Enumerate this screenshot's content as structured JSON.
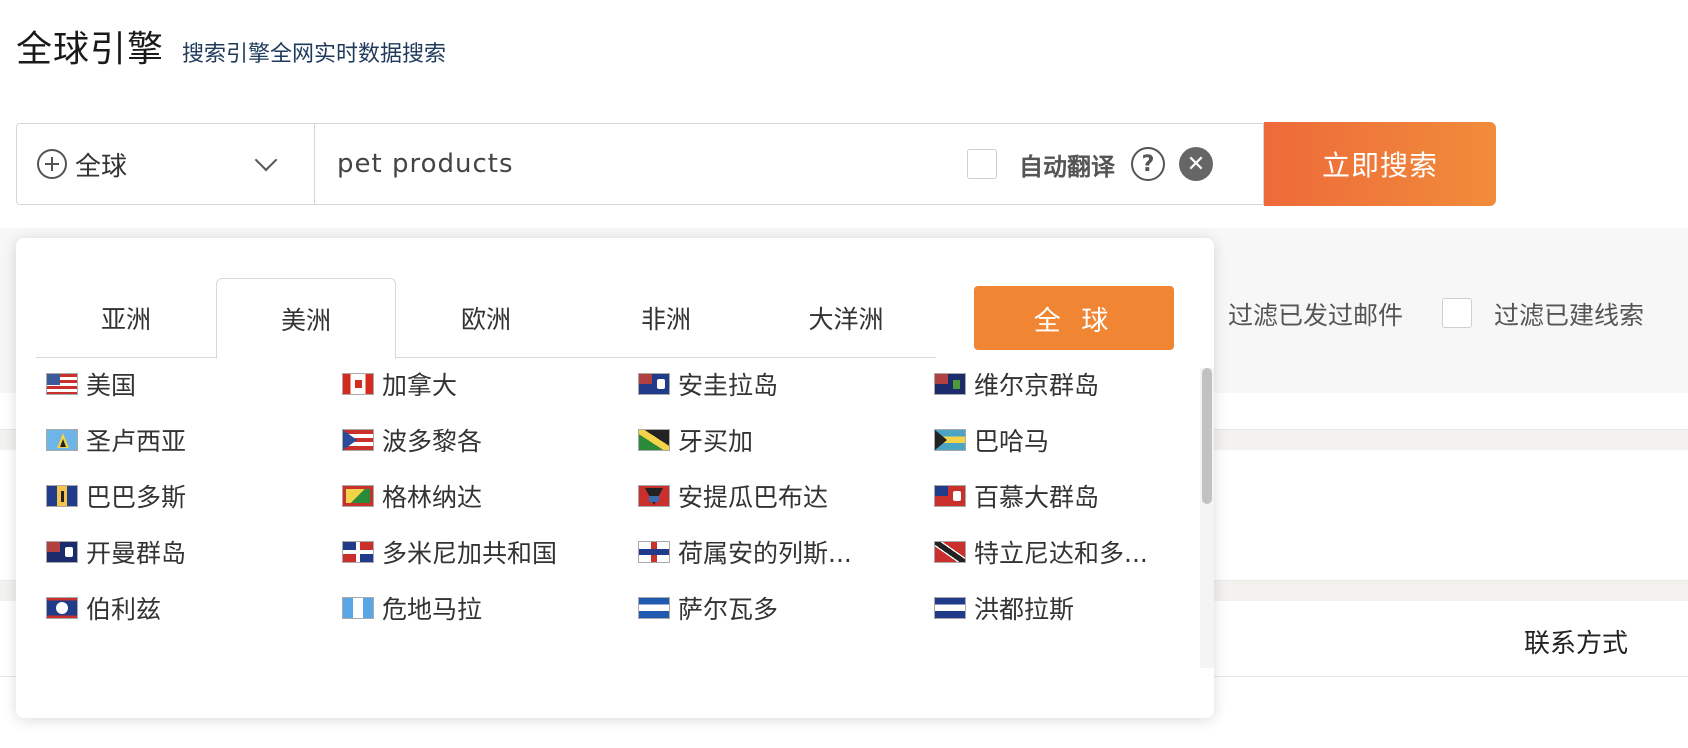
{
  "header": {
    "title": "全球引擎",
    "subtitle": "搜索引擎全网实时数据搜索"
  },
  "search": {
    "region": "全球",
    "query": "pet products",
    "auto_translate_label": "自动翻译",
    "auto_translate_checked": false,
    "help_glyph": "?",
    "clear_glyph": "✕",
    "button_label": "立即搜索"
  },
  "filters": {
    "sent_email_label": "过滤已发过邮件",
    "created_lead_label": "过滤已建线索"
  },
  "table": {
    "contact_header": "联系方式"
  },
  "dropdown": {
    "tabs": [
      "亚洲",
      "美洲",
      "欧洲",
      "非洲",
      "大洋洲"
    ],
    "active_tab": "美洲",
    "global_button": "全 球",
    "countries": [
      {
        "name": "美国",
        "flag": "us-flag"
      },
      {
        "name": "加拿大",
        "flag": "canada-flag"
      },
      {
        "name": "安圭拉岛",
        "flag": "anguilla-flag"
      },
      {
        "name": "维尔京群岛",
        "flag": "virgin-islands-flag"
      },
      {
        "name": "圣卢西亚",
        "flag": "saint-lucia-flag"
      },
      {
        "name": "波多黎各",
        "flag": "puerto-rico-flag"
      },
      {
        "name": "牙买加",
        "flag": "jamaica-flag"
      },
      {
        "name": "巴哈马",
        "flag": "bahamas-flag"
      },
      {
        "name": "巴巴多斯",
        "flag": "barbados-flag"
      },
      {
        "name": "格林纳达",
        "flag": "grenada-flag"
      },
      {
        "name": "安提瓜巴布达",
        "flag": "antigua-barbuda-flag"
      },
      {
        "name": "百慕大群岛",
        "flag": "bermuda-flag"
      },
      {
        "name": "开曼群岛",
        "flag": "cayman-islands-flag"
      },
      {
        "name": "多米尼加共和国",
        "flag": "dominican-republic-flag"
      },
      {
        "name": "荷属安的列斯...",
        "flag": "netherlands-antilles-flag"
      },
      {
        "name": "特立尼达和多...",
        "flag": "trinidad-tobago-flag"
      },
      {
        "name": "伯利兹",
        "flag": "belize-flag"
      },
      {
        "name": "危地马拉",
        "flag": "guatemala-flag"
      },
      {
        "name": "萨尔瓦多",
        "flag": "el-salvador-flag"
      },
      {
        "name": "洪都拉斯",
        "flag": "honduras-flag"
      }
    ]
  },
  "colors": {
    "accent": "#f08533",
    "search_button": "#ee6a39",
    "panel_bg": "#f7f7f7"
  }
}
